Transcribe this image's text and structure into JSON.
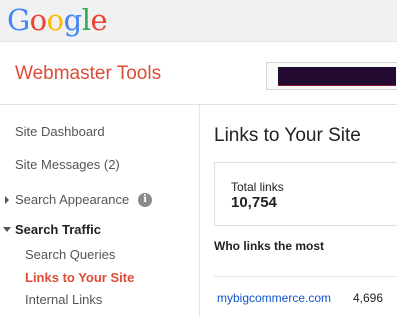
{
  "logo": {
    "letters": [
      {
        "char": "G",
        "color": "#4285f4"
      },
      {
        "char": "o",
        "color": "#ea4335"
      },
      {
        "char": "o",
        "color": "#fbbc05"
      },
      {
        "char": "g",
        "color": "#4285f4"
      },
      {
        "char": "l",
        "color": "#34a853"
      },
      {
        "char": "e",
        "color": "#ea4335"
      }
    ]
  },
  "header": {
    "product": "Webmaster Tools"
  },
  "sidebar": {
    "dashboard": "Site Dashboard",
    "messages": "Site Messages (2)",
    "search_appearance": "Search Appearance",
    "search_traffic": "Search Traffic",
    "search_queries": "Search Queries",
    "links_to_your_site": "Links to Your Site",
    "internal_links": "Internal Links",
    "info_icon": "i"
  },
  "main": {
    "title": "Links to Your Site",
    "total_label": "Total links",
    "total_value": "10,754",
    "who_heading": "Who links the most",
    "rows": [
      {
        "domain": "mybigcommerce.com",
        "count": "4,696"
      }
    ]
  },
  "colors": {
    "accent_red": "#dd4b39",
    "link_blue": "#1155cc"
  }
}
